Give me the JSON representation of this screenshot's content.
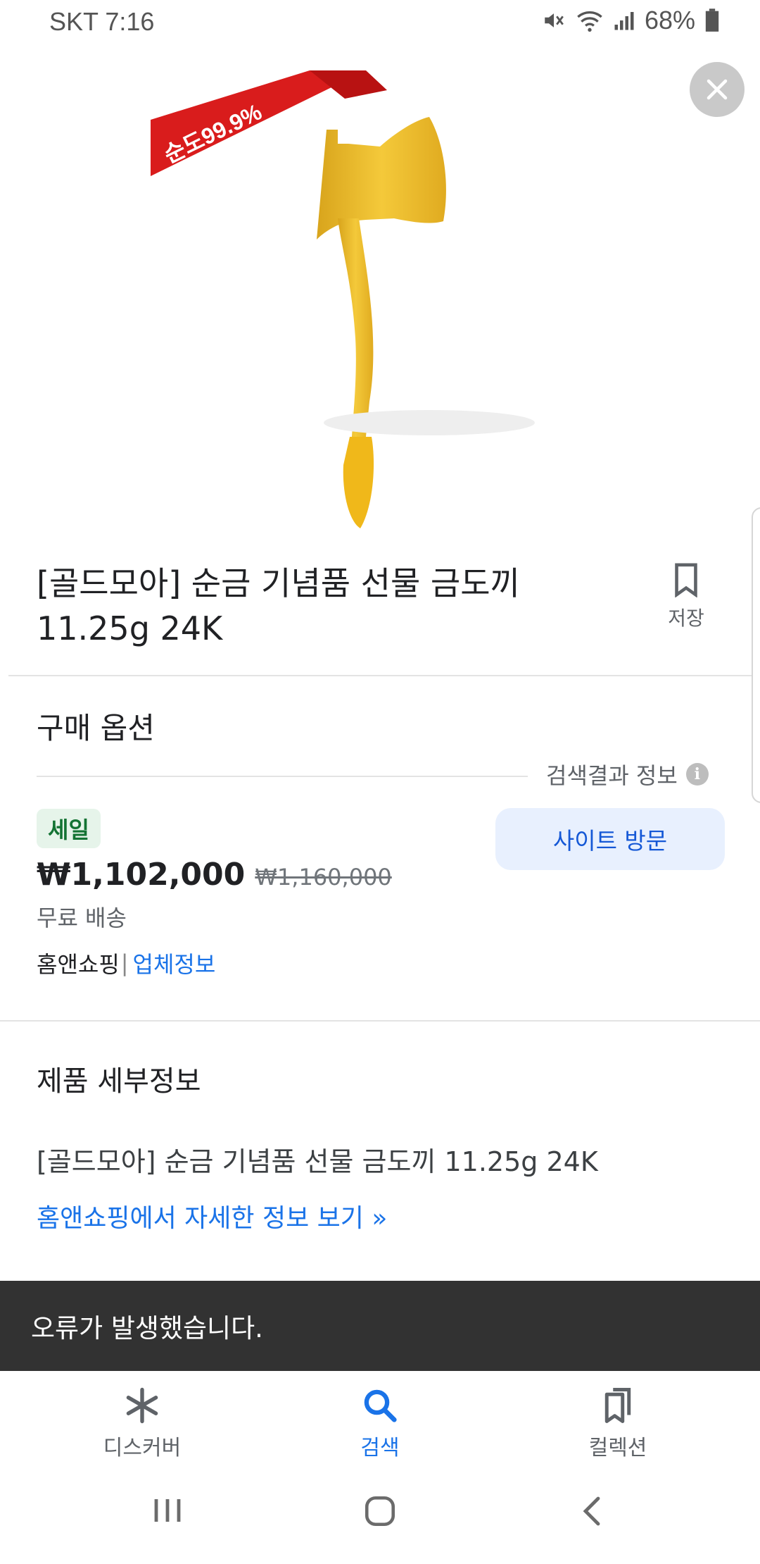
{
  "status_bar": {
    "carrier_time": "SKT 7:16",
    "battery": "68%"
  },
  "product": {
    "image_badge": "순도99.9%",
    "title": "[골드모아] 순금 기념품 선물 금도끼 11.25g 24K",
    "save_label": "저장"
  },
  "purchase_options": {
    "heading": "구매 옵션",
    "search_info": "검색결과 정보",
    "sale_badge": "세일",
    "price": "₩1,102,000",
    "old_price": "₩1,160,000",
    "shipping": "무료 배송",
    "seller": "홈앤쇼핑",
    "seller_separator": "|",
    "seller_info_link": "업체정보",
    "visit_button": "사이트 방문"
  },
  "details": {
    "heading": "제품 세부정보",
    "text": "[골드모아] 순금 기념품 선물 금도끼 11.25g 24K",
    "more_link": "홈앤쇼핑에서 자세한 정보 보기 »"
  },
  "snackbar": {
    "message": "오류가 발생했습니다."
  },
  "bottom_nav": {
    "items": [
      {
        "label": "디스커버",
        "icon": "asterisk-icon"
      },
      {
        "label": "검색",
        "icon": "search-icon",
        "active": true
      },
      {
        "label": "컬렉션",
        "icon": "collections-icon"
      }
    ]
  },
  "colors": {
    "accent": "#1a73e8",
    "sale_green": "#137333",
    "snackbar_bg": "#323232"
  }
}
